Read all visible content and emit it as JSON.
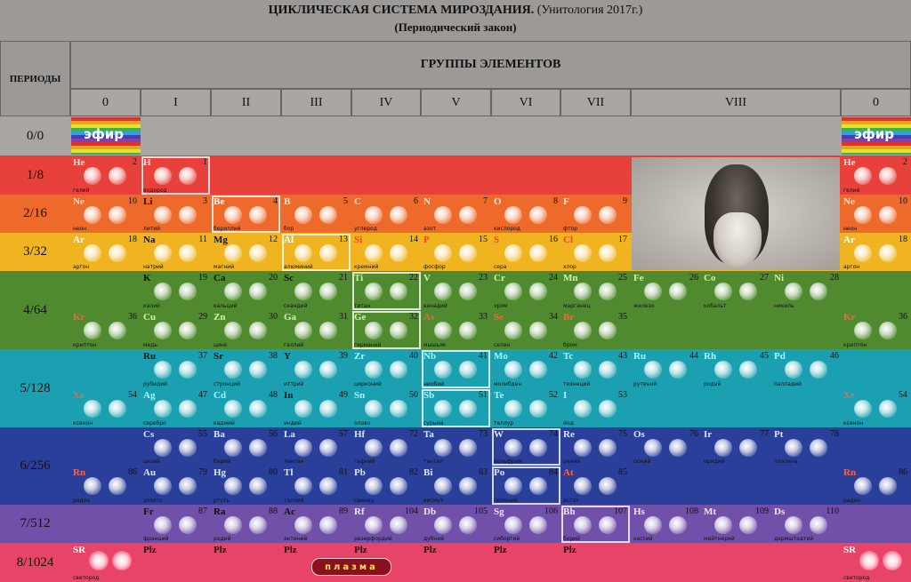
{
  "title": "ЦИКЛИЧЕСКАЯ СИСТЕМА МИРОЗДАНИЯ.",
  "title_suffix": "(Унитология 2017г.)",
  "subtitle": "(Периодический закон)",
  "periods_header": "ПЕРИОДЫ",
  "groups_header": "ГРУППЫ ЭЛЕМЕНТОВ",
  "groups": [
    "0",
    "I",
    "II",
    "III",
    "IV",
    "V",
    "VI",
    "VII",
    "VIII",
    "0"
  ],
  "periods": [
    "0/0",
    "1/8",
    "2/16",
    "3/32",
    "4/64",
    "5/128",
    "6/256",
    "7/512",
    "8/1024"
  ],
  "efir_label": "эфир",
  "plasma_label": "плазма",
  "plz_label": "Plz",
  "colors": {
    "row1": "#e8403a",
    "row2": "#ee6a2a",
    "row3": "#f0b420",
    "row4": "#4f8a2e",
    "row5": "#1aa0b0",
    "row6": "#2a3f9a",
    "row7": "#7050a8",
    "row8": "#e84468",
    "row0": "#a8a5a2"
  },
  "elements": [
    {
      "sym": "He",
      "num": "2",
      "name": "гелий"
    },
    {
      "sym": "H",
      "num": "1",
      "name": "водород"
    },
    {
      "sym": "He",
      "num": "2",
      "name": "гелий"
    },
    {
      "sym": "Ne",
      "num": "10",
      "name": "неон"
    },
    {
      "sym": "Li",
      "num": "3",
      "name": "литий"
    },
    {
      "sym": "Be",
      "num": "4",
      "name": "бериллий"
    },
    {
      "sym": "B",
      "num": "5",
      "name": "бор"
    },
    {
      "sym": "C",
      "num": "6",
      "name": "углерод"
    },
    {
      "sym": "N",
      "num": "7",
      "name": "азот"
    },
    {
      "sym": "O",
      "num": "8",
      "name": "кислород"
    },
    {
      "sym": "F",
      "num": "9",
      "name": "фтор"
    },
    {
      "sym": "Ne",
      "num": "10",
      "name": "неон"
    },
    {
      "sym": "Ar",
      "num": "18",
      "name": "аргон"
    },
    {
      "sym": "Na",
      "num": "11",
      "name": "натрий"
    },
    {
      "sym": "Mg",
      "num": "12",
      "name": "магний"
    },
    {
      "sym": "Al",
      "num": "13",
      "name": "алюминий"
    },
    {
      "sym": "Si",
      "num": "14",
      "name": "кремний"
    },
    {
      "sym": "P",
      "num": "15",
      "name": "фосфор"
    },
    {
      "sym": "S",
      "num": "16",
      "name": "сера"
    },
    {
      "sym": "Cl",
      "num": "17",
      "name": "хлор"
    },
    {
      "sym": "Ar",
      "num": "18",
      "name": "аргон"
    },
    {
      "sym": "K",
      "num": "19",
      "name": "калий"
    },
    {
      "sym": "Ca",
      "num": "20",
      "name": "кальций"
    },
    {
      "sym": "Sc",
      "num": "21",
      "name": "скандий"
    },
    {
      "sym": "Ti",
      "num": "22",
      "name": "титан"
    },
    {
      "sym": "V",
      "num": "23",
      "name": "ванадий"
    },
    {
      "sym": "Cr",
      "num": "24",
      "name": "хром"
    },
    {
      "sym": "Mn",
      "num": "25",
      "name": "марганец"
    },
    {
      "sym": "Fe",
      "num": "26",
      "name": "железо"
    },
    {
      "sym": "Co",
      "num": "27",
      "name": "кобальт"
    },
    {
      "sym": "Ni",
      "num": "28",
      "name": "никель"
    },
    {
      "sym": "Kr",
      "num": "36",
      "name": "криптон"
    },
    {
      "sym": "Cu",
      "num": "29",
      "name": "медь"
    },
    {
      "sym": "Zn",
      "num": "30",
      "name": "цинк"
    },
    {
      "sym": "Ga",
      "num": "31",
      "name": "галлий"
    },
    {
      "sym": "Ge",
      "num": "32",
      "name": "германий"
    },
    {
      "sym": "As",
      "num": "33",
      "name": "мышьяк"
    },
    {
      "sym": "Se",
      "num": "34",
      "name": "селен"
    },
    {
      "sym": "Br",
      "num": "35",
      "name": "бром"
    },
    {
      "sym": "Kr",
      "num": "36",
      "name": "криптон"
    },
    {
      "sym": "Ru",
      "num": "37",
      "name": "рубидий"
    },
    {
      "sym": "Sr",
      "num": "38",
      "name": "стронций"
    },
    {
      "sym": "Y",
      "num": "39",
      "name": "иттрий"
    },
    {
      "sym": "Zr",
      "num": "40",
      "name": "цирконий"
    },
    {
      "sym": "Nb",
      "num": "41",
      "name": "ниобий"
    },
    {
      "sym": "Mo",
      "num": "42",
      "name": "молибден"
    },
    {
      "sym": "Tc",
      "num": "43",
      "name": "технеций"
    },
    {
      "sym": "Ru",
      "num": "44",
      "name": "рутений"
    },
    {
      "sym": "Rh",
      "num": "45",
      "name": "родий"
    },
    {
      "sym": "Pd",
      "num": "46",
      "name": "палладий"
    },
    {
      "sym": "Xe",
      "num": "54",
      "name": "ксенон"
    },
    {
      "sym": "Ag",
      "num": "47",
      "name": "серебро"
    },
    {
      "sym": "Cd",
      "num": "48",
      "name": "кадмий"
    },
    {
      "sym": "In",
      "num": "49",
      "name": "индий"
    },
    {
      "sym": "Sn",
      "num": "50",
      "name": "олово"
    },
    {
      "sym": "Sb",
      "num": "51",
      "name": "сурьма"
    },
    {
      "sym": "Te",
      "num": "52",
      "name": "теллур"
    },
    {
      "sym": "I",
      "num": "53",
      "name": "йод"
    },
    {
      "sym": "Xe",
      "num": "54",
      "name": "ксенон"
    },
    {
      "sym": "Cs",
      "num": "55",
      "name": "цезий"
    },
    {
      "sym": "Ba",
      "num": "56",
      "name": "барий"
    },
    {
      "sym": "La",
      "num": "57",
      "name": "лантан"
    },
    {
      "sym": "Hf",
      "num": "72",
      "name": "гафний"
    },
    {
      "sym": "Ta",
      "num": "73",
      "name": "тантал"
    },
    {
      "sym": "W",
      "num": "74",
      "name": "вольфрам"
    },
    {
      "sym": "Re",
      "num": "75",
      "name": "рений"
    },
    {
      "sym": "Os",
      "num": "76",
      "name": "осмий"
    },
    {
      "sym": "Ir",
      "num": "77",
      "name": "иридий"
    },
    {
      "sym": "Pt",
      "num": "78",
      "name": "платина"
    },
    {
      "sym": "Rn",
      "num": "86",
      "name": "радон"
    },
    {
      "sym": "Au",
      "num": "79",
      "name": "золото"
    },
    {
      "sym": "Hg",
      "num": "80",
      "name": "ртуть"
    },
    {
      "sym": "Tl",
      "num": "81",
      "name": "таллий"
    },
    {
      "sym": "Pb",
      "num": "82",
      "name": "свинец"
    },
    {
      "sym": "Bi",
      "num": "83",
      "name": "висмут"
    },
    {
      "sym": "Po",
      "num": "84",
      "name": "полоний"
    },
    {
      "sym": "At",
      "num": "85",
      "name": "астат"
    },
    {
      "sym": "Rn",
      "num": "86",
      "name": "радон"
    },
    {
      "sym": "Fr",
      "num": "87",
      "name": "франций"
    },
    {
      "sym": "Ra",
      "num": "88",
      "name": "радий"
    },
    {
      "sym": "Ac",
      "num": "89",
      "name": "актиний"
    },
    {
      "sym": "Rf",
      "num": "104",
      "name": "резерфордий"
    },
    {
      "sym": "Db",
      "num": "105",
      "name": "дубний"
    },
    {
      "sym": "Sg",
      "num": "106",
      "name": "сиборгий"
    },
    {
      "sym": "Bh",
      "num": "107",
      "name": "борий"
    },
    {
      "sym": "Hs",
      "num": "108",
      "name": "хассий"
    },
    {
      "sym": "Mt",
      "num": "109",
      "name": "мейтнерий"
    },
    {
      "sym": "Ds",
      "num": "110",
      "name": "дармштадтий"
    },
    {
      "sym": "SR",
      "num": "",
      "name": "светород"
    },
    {
      "sym": "SR",
      "num": "",
      "name": "светород"
    }
  ]
}
